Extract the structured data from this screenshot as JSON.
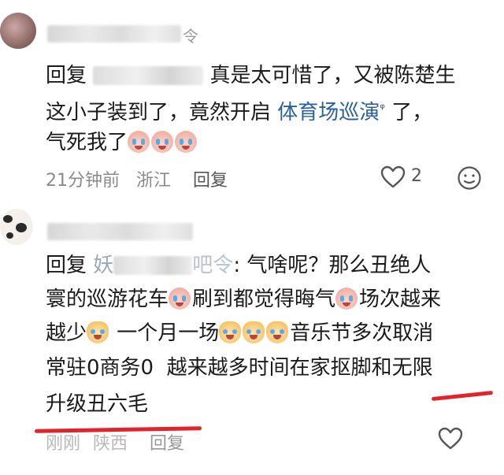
{
  "comments": [
    {
      "name_visible_tail": "令",
      "reply_prefix": "回复",
      "line1_tail": "真是太可惜了，又被陈楚生",
      "line2_head": "这小子装到了，竟然开启",
      "line2_link": "体育场巡演",
      "line2_tail": "了，",
      "line3": "气死我了",
      "time": "21分钟前",
      "location": "浙江",
      "reply_label": "回复",
      "like_count": "2"
    },
    {
      "name_visible_tail": "吧令",
      "reply_prefix": "回复",
      "reply_target_head": "妖",
      "line1_tail": ": 气啥呢？那么丑绝人",
      "line2_a": "寰的巡游花车",
      "line2_b": "刷到都觉得晦气",
      "line2_c": "场次越来",
      "line3_a": "越少",
      "line3_b": "一个月一场",
      "line3_c": "音乐节多次取消",
      "line4": "常驻0商务0  越来越多时间在家抠脚和无限",
      "line5": "升级丑六毛",
      "time": "刚刚",
      "location": "陕西",
      "reply_label": "回复"
    }
  ],
  "icons": {
    "like": "heart-outline-icon",
    "emoji_react": "smiley-icon",
    "link": "search-link-icon"
  },
  "colors": {
    "link": "#2b5f9e",
    "annotation": "#e0242c"
  }
}
